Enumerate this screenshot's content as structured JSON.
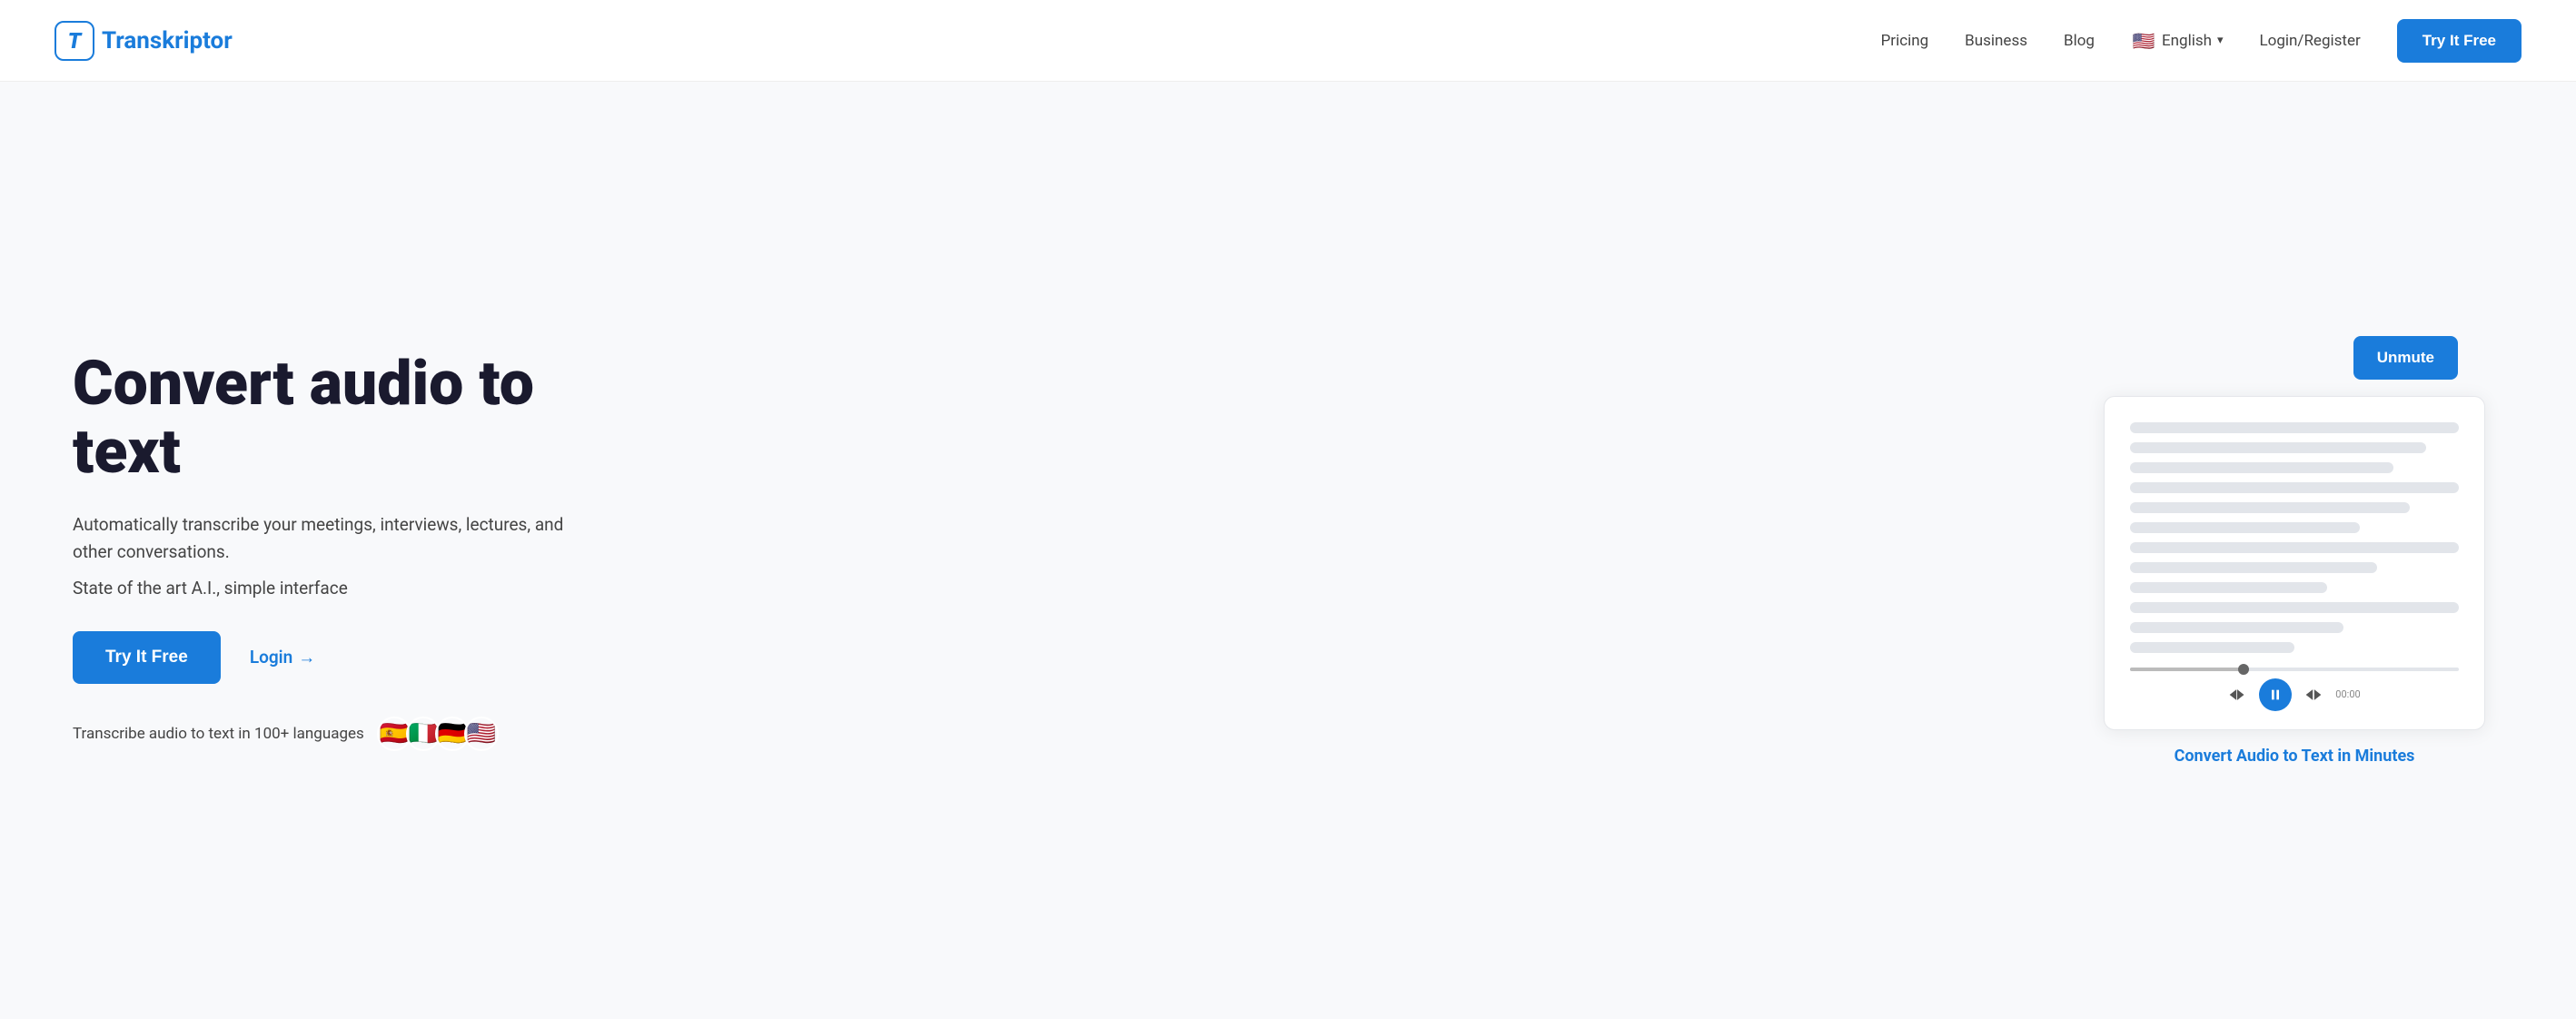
{
  "brand": {
    "letter": "T",
    "name": "ranskriptor"
  },
  "nav": {
    "pricing": "Pricing",
    "business": "Business",
    "blog": "Blog",
    "language": "English",
    "language_flag": "🇺🇸",
    "login_register": "Login/Register",
    "try_free": "Try It Free"
  },
  "hero": {
    "title": "Convert audio to text",
    "subtitle": "Automatically transcribe your meetings, interviews, lectures, and other conversations.",
    "tagline": "State of the art A.I., simple interface",
    "try_free": "Try It Free",
    "login": "Login",
    "login_arrow": "→",
    "lang_text": "Transcribe audio to text in 100+ languages",
    "flags": [
      "🇪🇸",
      "🇮🇹",
      "🇩🇪",
      "🇺🇸"
    ],
    "unmute": "Unmute",
    "demo_caption": "Convert Audio to Text in Minutes",
    "time": "00:00"
  }
}
